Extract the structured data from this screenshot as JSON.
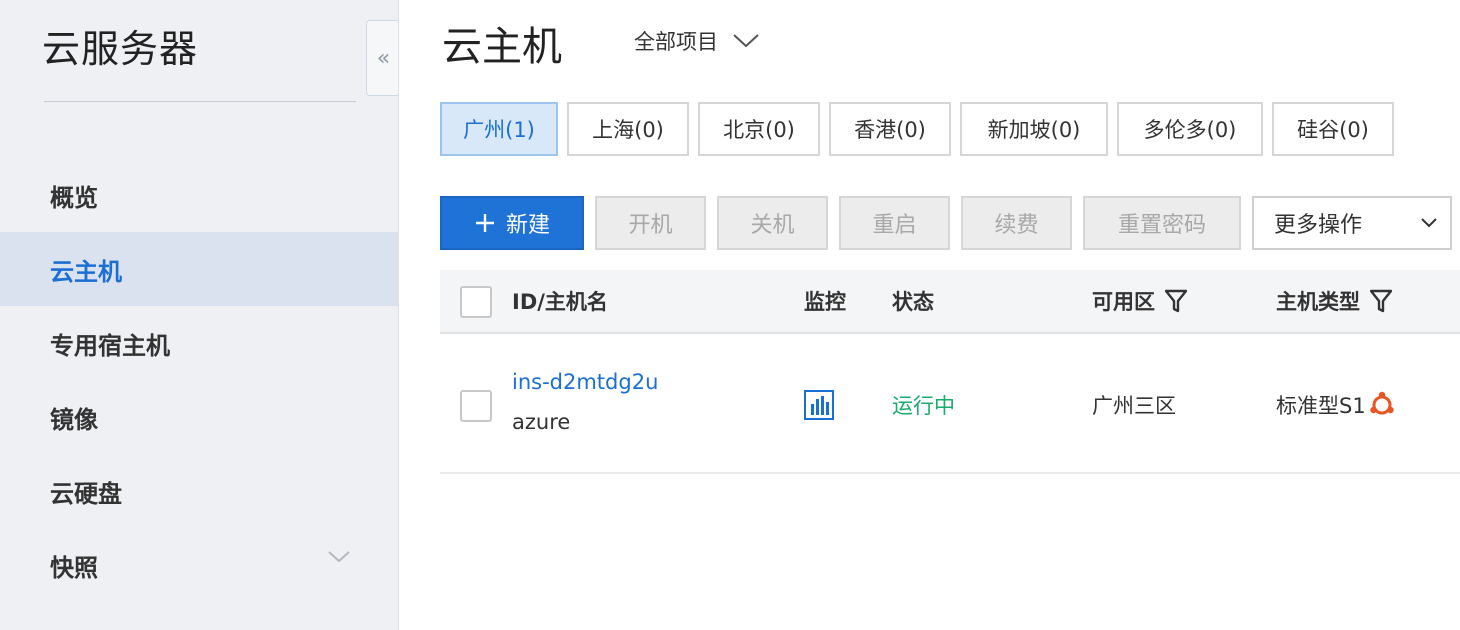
{
  "sidebar": {
    "title": "云服务器",
    "items": [
      {
        "label": "概览",
        "active": false
      },
      {
        "label": "云主机",
        "active": true
      },
      {
        "label": "专用宿主机",
        "active": false
      },
      {
        "label": "镜像",
        "active": false
      },
      {
        "label": "云硬盘",
        "active": false
      },
      {
        "label": "快照",
        "active": false,
        "has_chevron": true
      }
    ],
    "collapse_icon": "double-chevron-left-icon"
  },
  "header": {
    "title": "云主机",
    "project_select": "全部项目"
  },
  "regions": [
    {
      "label": "广州(1)",
      "active": true
    },
    {
      "label": "上海(0)"
    },
    {
      "label": "北京(0)"
    },
    {
      "label": "香港(0)"
    },
    {
      "label": "新加坡(0)"
    },
    {
      "label": "多伦多(0)"
    },
    {
      "label": "硅谷(0)"
    }
  ],
  "toolbar": {
    "new_label": "新建",
    "power_on": "开机",
    "power_off": "关机",
    "restart": "重启",
    "renew": "续费",
    "reset_password": "重置密码",
    "more_actions": "更多操作"
  },
  "table": {
    "headers": {
      "id_name": "ID/主机名",
      "monitor": "监控",
      "status": "状态",
      "zone": "可用区",
      "type": "主机类型"
    },
    "rows": [
      {
        "id": "ins-d2mtdg2u",
        "name": "azure",
        "monitor_icon": "bar-chart-icon",
        "status": "运行中",
        "zone": "广州三区",
        "type": "标准型S1",
        "os_icon": "ubuntu-icon"
      }
    ]
  },
  "colors": {
    "accent": "#1a6fd5",
    "primary_button": "#1f73d6",
    "running": "#1bab6b",
    "sidebar_bg": "#eef0f3",
    "sidebar_active": "#d9e2ee",
    "ubuntu_orange": "#e95420"
  }
}
